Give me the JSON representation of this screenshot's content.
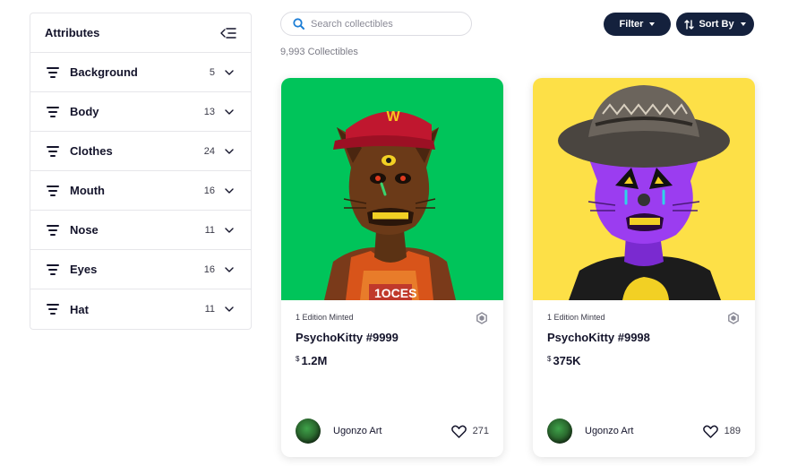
{
  "sidebar": {
    "title": "Attributes",
    "items": [
      {
        "label": "Background",
        "count": "5"
      },
      {
        "label": "Body",
        "count": "13"
      },
      {
        "label": "Clothes",
        "count": "24"
      },
      {
        "label": "Mouth",
        "count": "16"
      },
      {
        "label": "Nose",
        "count": "11"
      },
      {
        "label": "Eyes",
        "count": "16"
      },
      {
        "label": "Hat",
        "count": "11"
      }
    ]
  },
  "search": {
    "placeholder": "Search collectibles",
    "value": ""
  },
  "collection": {
    "count_text": "9,993 Collectibles"
  },
  "toolbar": {
    "filter_label": "Filter",
    "sort_label": "Sort By",
    "accent": "#14213d"
  },
  "cards": [
    {
      "edition": "1 Edition Minted",
      "name": "PsychoKitty #9999",
      "currency": "$",
      "price": "1.2M",
      "creator": "Ugonzo Art",
      "likes": "271",
      "background_color": "#00c45a"
    },
    {
      "edition": "1 Edition Minted",
      "name": "PsychoKitty #9998",
      "currency": "$",
      "price": "375K",
      "creator": "Ugonzo Art",
      "likes": "189",
      "background_color": "#fde047"
    }
  ],
  "icons": {
    "search": "search-icon",
    "collapse": "collapse-sidebar-icon",
    "attribute": "filter-lines-icon",
    "chevron": "chevron-down-icon",
    "sort": "sort-arrows-icon",
    "chain": "hexagon-chain-icon",
    "like": "heart-icon"
  }
}
